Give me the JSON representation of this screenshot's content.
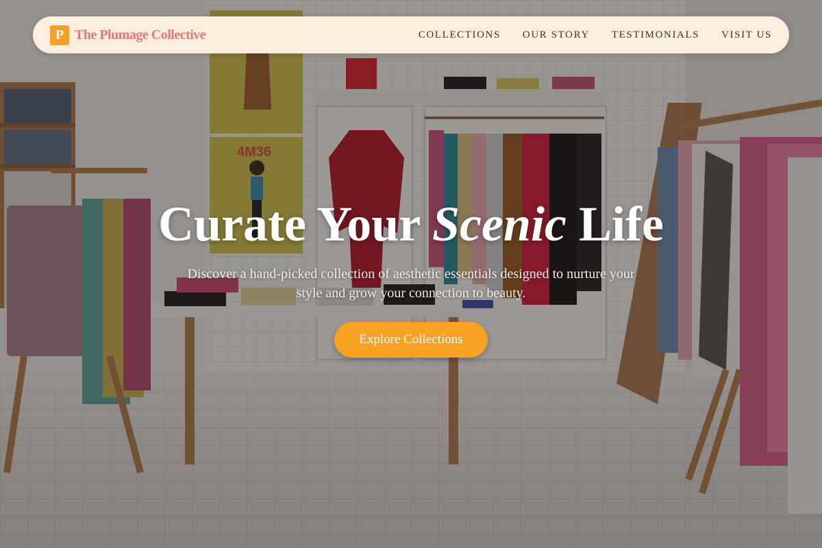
{
  "brand": {
    "logo_letter": "P",
    "name": "The Plumage Collective"
  },
  "nav": {
    "items": [
      {
        "label": "COLLECTIONS"
      },
      {
        "label": "OUR STORY"
      },
      {
        "label": "TESTIMONIALS"
      },
      {
        "label": "VISIT US"
      }
    ]
  },
  "hero": {
    "title_part1": "Curate Your ",
    "title_emphasis": "Scenic",
    "title_part2": " Life",
    "subtitle": "Discover a hand-picked collection of aesthetic essentials designed to nurture your style and grow your connection to beauty.",
    "cta_label": "Explore Collections"
  },
  "scene": {
    "poster_text": "4M36"
  },
  "colors": {
    "accent": "#f6a024",
    "brand_text": "#e5787a",
    "navbar_bg": "#fbeedc"
  }
}
